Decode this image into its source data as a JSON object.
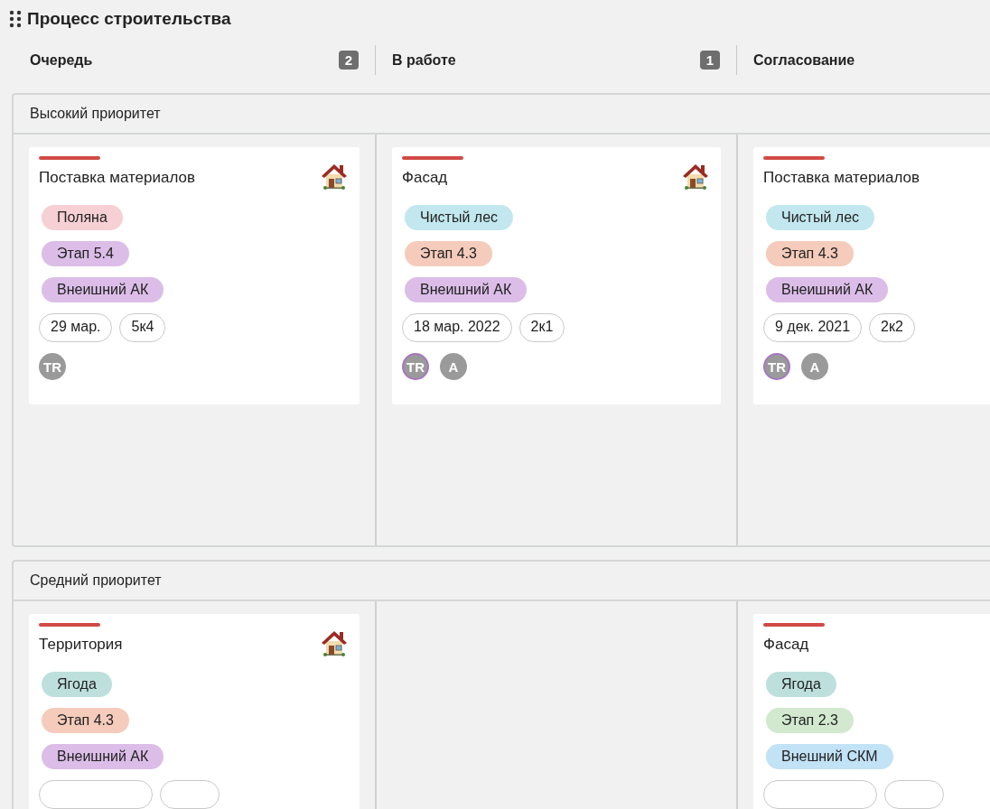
{
  "board": {
    "title": "Процесс строительства"
  },
  "columns": [
    {
      "name": "Очередь",
      "count": "2"
    },
    {
      "name": "В работе",
      "count": "1"
    },
    {
      "name": "Согласование"
    }
  ],
  "lanes": [
    {
      "title": "Высокий приоритет",
      "cells": [
        [
          {
            "title": "Поставка материалов",
            "house": true,
            "tags": [
              {
                "text": "Поляна",
                "color": "#f6d0d4"
              },
              {
                "text": "Этап 5.4",
                "color": "#dcbde8"
              },
              {
                "text": "Внеишний АК",
                "color": "#dcbde8"
              }
            ],
            "chips": [
              "29 мар.",
              "5к4"
            ],
            "avatars": [
              {
                "initials": "TR",
                "ring": false
              }
            ]
          }
        ],
        [
          {
            "title": "Фасад",
            "house": true,
            "tags": [
              {
                "text": "Чистый лес",
                "color": "#c2e7ef"
              },
              {
                "text": "Этап 4.3",
                "color": "#f5cbbb"
              },
              {
                "text": "Внеишний АК",
                "color": "#dcbde8"
              }
            ],
            "chips": [
              "18 мар. 2022",
              "2к1"
            ],
            "avatars": [
              {
                "initials": "TR",
                "ring": true
              },
              {
                "initials": "A",
                "ring": false
              }
            ]
          }
        ],
        [
          {
            "title": "Поставка материалов",
            "tags": [
              {
                "text": "Чистый лес",
                "color": "#c2e7ef"
              },
              {
                "text": "Этап 4.3",
                "color": "#f5cbbb"
              },
              {
                "text": "Внеишний АК",
                "color": "#dcbde8"
              }
            ],
            "chips": [
              "9 дек. 2021",
              "2к2"
            ],
            "avatars": [
              {
                "initials": "TR",
                "ring": true
              },
              {
                "initials": "A",
                "ring": false
              }
            ]
          }
        ]
      ]
    },
    {
      "title": "Средний приоритет",
      "cells": [
        [
          {
            "title": "Территория",
            "house": true,
            "tags": [
              {
                "text": "Ягода",
                "color": "#bde0dd"
              },
              {
                "text": "Этап 4.3",
                "color": "#f5cbbb"
              },
              {
                "text": "Внеишний АК",
                "color": "#dcbde8"
              }
            ],
            "chips_clipped": true
          }
        ],
        [],
        [
          {
            "title": "Фасад",
            "tags": [
              {
                "text": "Ягода",
                "color": "#bde0dd"
              },
              {
                "text": "Этап 2.3",
                "color": "#d2e9cf"
              },
              {
                "text": "Внешний СКМ",
                "color": "#c2e2f6"
              }
            ],
            "chips_clipped": true
          }
        ]
      ]
    }
  ]
}
